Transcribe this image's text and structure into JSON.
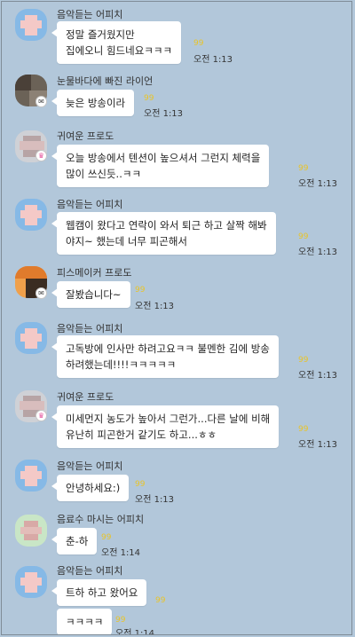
{
  "messages": [
    {
      "sender": "음악듣는 어피치",
      "avatar": "pink-character-avatar",
      "badge": "",
      "lines": [
        "정말 즐거웠지만",
        "집에오니 힘드네요ㅋㅋㅋ"
      ],
      "unread": "99",
      "time": "오전 1:13"
    },
    {
      "sender": "눈물바다에 빠진 라이언",
      "avatar": "photo-avatar",
      "badge": "chat-icon",
      "lines": [
        "늦은 방송이라"
      ],
      "unread": "99",
      "time": "오전 1:13"
    },
    {
      "sender": "귀여운 프로도",
      "avatar": "grey-character-avatar",
      "badge": "crown-icon",
      "lines": [
        "오늘 방송에서 텐션이 높으셔서 그런지 체력을",
        "많이 쓰신듯..ㅋㅋ"
      ],
      "unread": "99",
      "time": "오전 1:13"
    },
    {
      "sender": "음악듣는 어피치",
      "avatar": "pink-character-avatar",
      "badge": "",
      "lines": [
        "웹캠이 왔다고 연락이 와서 퇴근 하고 살짝 해봐",
        "야지~ 했는데 너무 피곤해서"
      ],
      "unread": "99",
      "time": "오전 1:13"
    },
    {
      "sender": "피스메이커 프로도",
      "avatar": "orange-photo-avatar",
      "badge": "chat-icon",
      "lines": [
        "잘봤습니다~"
      ],
      "unread": "99",
      "time": "오전 1:13"
    },
    {
      "sender": "음악듣는 어피치",
      "avatar": "pink-character-avatar",
      "badge": "",
      "lines": [
        "고독방에 인사만 하려고요ㅋㅋ 불멘한 김에 방송",
        "하려했는데!!!!ㅋㅋㅋㅋㅋ"
      ],
      "unread": "99",
      "time": "오전 1:13"
    },
    {
      "sender": "귀여운 프로도",
      "avatar": "grey-character-avatar",
      "badge": "crown-icon",
      "lines": [
        "미세먼지 농도가 높아서 그런가...다른 날에 비해",
        "유난히 피곤한거 같기도 하고...ㅎㅎ"
      ],
      "unread": "99",
      "time": "오전 1:13"
    },
    {
      "sender": "음악듣는 어피치",
      "avatar": "pink-character-avatar",
      "badge": "",
      "lines": [
        "안녕하세요:)"
      ],
      "unread": "99",
      "time": "오전 1:13"
    },
    {
      "sender": "음료수 마시는 어피치",
      "avatar": "green-character-avatar",
      "badge": "",
      "lines": [
        "춘-하"
      ],
      "unread": "99",
      "time": "오전 1:14"
    },
    {
      "sender": "음악듣는 어피치",
      "avatar": "pink-character-avatar",
      "badge": "",
      "lines": [
        "트하 하고 왔어요"
      ],
      "unread": "99",
      "time": "오전 1:14"
    },
    {
      "sender": "",
      "avatar": "",
      "badge": "",
      "lines": [
        "ㅋㅋㅋㅋ"
      ],
      "unread": "99",
      "time": "오전 1:14"
    }
  ],
  "colors": {
    "background": "#b2c7da",
    "bubble": "#ffffff",
    "unread": "#e8c42a"
  }
}
